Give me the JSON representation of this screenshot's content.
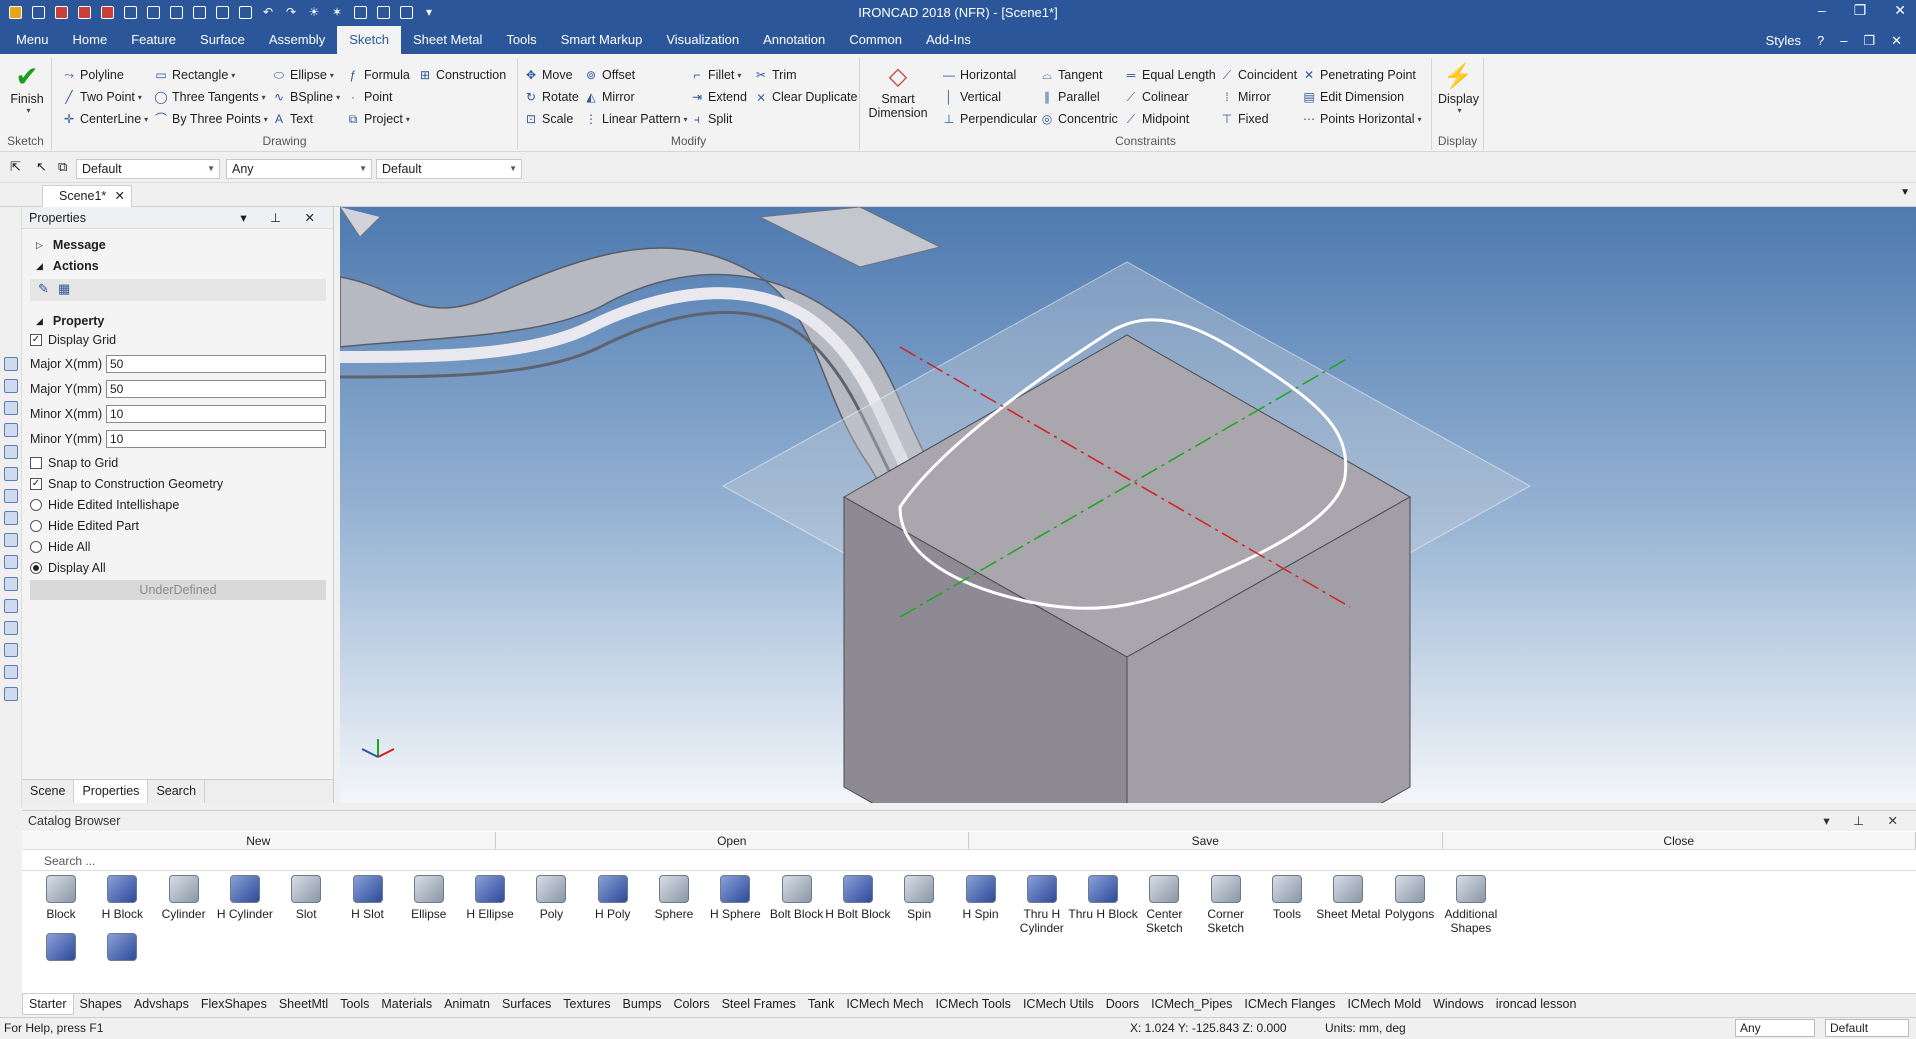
{
  "titlebar": {
    "title": "IRONCAD 2018 (NFR) - [Scene1*]",
    "controls": [
      "–",
      "❐",
      "✕"
    ]
  },
  "menu_tabs": [
    "Menu",
    "Home",
    "Feature",
    "Surface",
    "Assembly",
    "Sketch",
    "Sheet Metal",
    "Tools",
    "Smart Markup",
    "Visualization",
    "Annotation",
    "Common",
    "Add-Ins"
  ],
  "active_tab": "Sketch",
  "menu_right": {
    "styles": "Styles"
  },
  "ribbon": {
    "finish": "Finish",
    "groups": {
      "sketch": "Sketch",
      "drawing": "Drawing",
      "modify": "Modify",
      "constraints": "Constraints",
      "display": "Display"
    },
    "drawing": [
      "Polyline",
      "Two Point",
      "CenterLine",
      "Rectangle",
      "Three Tangents",
      "By Three Points",
      "Ellipse",
      "BSpline",
      "Text",
      "Formula",
      "Point",
      "Project",
      "Construction"
    ],
    "modify": [
      "Move",
      "Rotate",
      "Scale",
      "Offset",
      "Mirror",
      "Linear Pattern",
      "Fillet",
      "Extend",
      "Split",
      "Trim",
      "Clear Duplicate"
    ],
    "smart_dimension": "Smart Dimension",
    "constraints": [
      "Horizontal",
      "Vertical",
      "Perpendicular",
      "Tangent",
      "Parallel",
      "Concentric",
      "Equal Length",
      "Colinear",
      "Midpoint",
      "Coincident",
      "Mirror",
      "Fixed",
      "Penetrating Point",
      "Edit Dimension",
      "Points Horizontal"
    ],
    "display": "Display"
  },
  "optbar": {
    "combo1": "Default",
    "combo2": "Any",
    "combo3": "Default"
  },
  "doc_tab": "Scene1*",
  "props": {
    "title": "Properties",
    "message": "Message",
    "actions": "Actions",
    "property": "Property",
    "display_grid": "Display Grid",
    "fields": [
      {
        "label": "Major X(mm)",
        "value": "50"
      },
      {
        "label": "Major Y(mm)",
        "value": "50"
      },
      {
        "label": "Minor X(mm)",
        "value": "10"
      },
      {
        "label": "Minor Y(mm)",
        "value": "10"
      }
    ],
    "options": [
      "Snap to Grid",
      "Snap to Construction Geometry",
      "Hide Edited Intellishape",
      "Hide Edited Part",
      "Hide All",
      "Display All"
    ],
    "underdefined": "UnderDefined",
    "tabs": [
      "Scene",
      "Properties",
      "Search"
    ]
  },
  "catalog": {
    "title": "Catalog Browser",
    "buttons": [
      "New",
      "Open",
      "Save",
      "Close"
    ],
    "search": "Search ...",
    "items": [
      "Block",
      "H Block",
      "Cylinder",
      "H Cylinder",
      "Slot",
      "H Slot",
      "Ellipse",
      "H Ellipse",
      "Poly",
      "H Poly",
      "Sphere",
      "H Sphere",
      "Bolt Block",
      "H Bolt Block",
      "Spin",
      "H Spin",
      "Thru H Cylinder",
      "Thru H Block",
      "Center Sketch",
      "Corner Sketch",
      "Tools",
      "Sheet Metal",
      "Polygons",
      "Additional Shapes"
    ],
    "tabs": [
      "Starter",
      "Shapes",
      "Advshaps",
      "FlexShapes",
      "SheetMtl",
      "Tools",
      "Materials",
      "Animatn",
      "Surfaces",
      "Textures",
      "Bumps",
      "Colors",
      "Steel Frames",
      "Tank",
      "ICMech Mech",
      "ICMech Tools",
      "ICMech Utils",
      "Doors",
      "ICMech_Pipes",
      "ICMech Flanges",
      "ICMech Mold",
      "Windows",
      "ironcad lesson"
    ]
  },
  "status": {
    "help": "For Help, press F1",
    "coords": "X: 1.024 Y: -125.843 Z: 0.000",
    "units": "Units: mm, deg",
    "combo_any": "Any",
    "combo_default": "Default"
  },
  "colors": {
    "accent": "#2b579a",
    "xaxis": "#d32020",
    "yaxis": "#1aa81a"
  }
}
